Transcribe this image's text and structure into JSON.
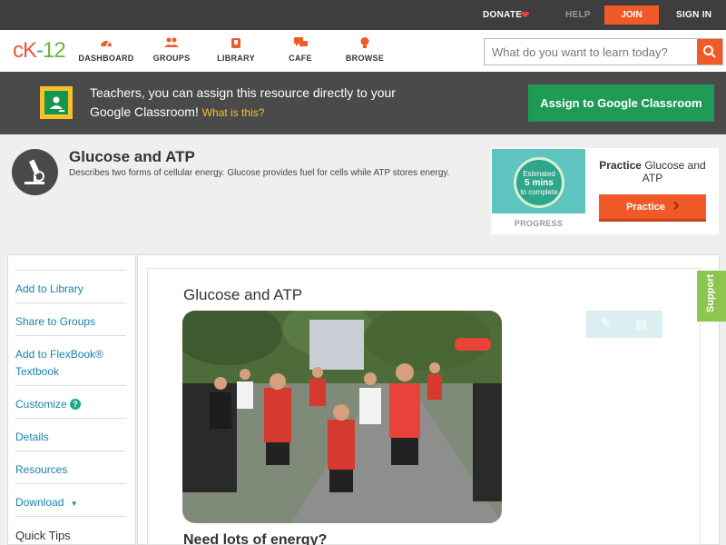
{
  "topbar": {
    "donate": "DONATE",
    "help": "HELP",
    "join": "JOIN",
    "signin": "SIGN IN"
  },
  "nav": {
    "logo": {
      "ck": "cK",
      "dash": "-",
      "num": "12"
    },
    "items": [
      {
        "label": "DASHBOARD",
        "icon": "dashboard-icon"
      },
      {
        "label": "GROUPS",
        "icon": "groups-icon"
      },
      {
        "label": "LIBRARY",
        "icon": "library-icon"
      },
      {
        "label": "CAFE",
        "icon": "cafe-icon"
      },
      {
        "label": "BROWSE",
        "icon": "browse-icon"
      }
    ],
    "search_placeholder": "What do you want to learn today?"
  },
  "banner": {
    "text": "Teachers, you can assign this resource directly to your Google Classroom!",
    "what_is_this": "What is this?",
    "assign_label": "Assign to Google Classroom"
  },
  "concept": {
    "title": "Glucose and ATP",
    "description": "Describes two forms of cellular energy. Glucose provides fuel for cells while ATP stores energy."
  },
  "practice_card": {
    "estimated_line1": "Estimated",
    "estimated_line2": "5 mins",
    "estimated_line3": "to complete",
    "progress_label": "PROGRESS",
    "practice_prefix": "Practice",
    "practice_topic": "Glucose and ATP",
    "button_label": "Practice"
  },
  "sidebar": {
    "items": [
      {
        "label": "Add to Library"
      },
      {
        "label": "Share to Groups"
      },
      {
        "label": "Add to FlexBook® Textbook"
      },
      {
        "label": "Customize"
      },
      {
        "label": "Details"
      },
      {
        "label": "Resources"
      },
      {
        "label": "Download"
      },
      {
        "label": "Quick Tips"
      }
    ]
  },
  "lesson": {
    "title": "Glucose and ATP",
    "subhead": "Need lots of energy?"
  },
  "support_label": "Support",
  "colors": {
    "accent": "#f05a28",
    "green": "#1f9b56",
    "link": "#1a83ad",
    "dark": "#3e3e3e"
  }
}
